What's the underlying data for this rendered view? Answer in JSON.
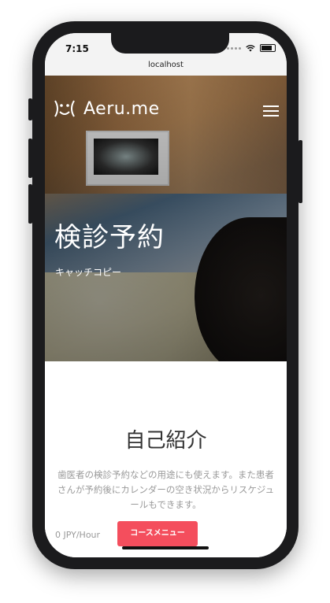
{
  "status": {
    "time": "7:15"
  },
  "browser": {
    "url": "localhost"
  },
  "header": {
    "logo_text": "Aeru.me"
  },
  "hero": {
    "title": "検診予約",
    "subtitle": "キャッチコピー"
  },
  "about": {
    "title": "自己紹介",
    "body": "歯医者の検診予約などの用途にも使えます。また患者さんが予約後にカレンダーの空き状況からリスケジュールもできます。"
  },
  "offer": {
    "price": "0 JPY/Hour",
    "button_label": "コースメニュー"
  },
  "icons": {
    "menu": "hamburger-menu-icon",
    "logo": "smile-logo-icon",
    "wifi": "wifi-icon",
    "battery": "battery-icon"
  },
  "colors": {
    "accent": "#f44e5d",
    "text": "#333333",
    "muted": "#9a9a9a"
  }
}
